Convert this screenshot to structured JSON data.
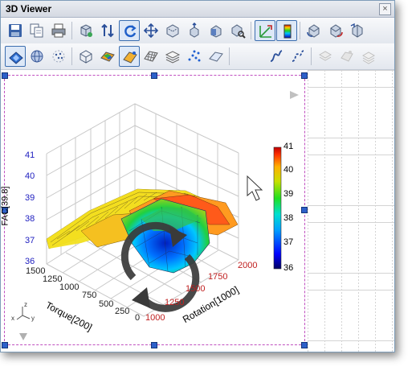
{
  "window": {
    "title": "3D Viewer",
    "close_glyph": "×"
  },
  "toolbar_row1": [
    "save-icon",
    "copy-icon",
    "print-icon",
    "rotate-box-icon",
    "align-axis-icon",
    "rotate-icon",
    "move-icon",
    "box-view-icon",
    "box-up-icon",
    "box-front-icon",
    "box-zoom-icon",
    "axis-swap-icon",
    "colorbar-icon",
    "cube-rotate-left-icon",
    "cube-rotate-right-icon",
    "cube-flip-icon"
  ],
  "toolbar_row2": [
    "surface-blue-icon",
    "sphere-grid-icon",
    "sphere-dots-icon",
    "wireframe-box-icon",
    "surface-color-icon",
    "surface-flat-icon",
    "mesh-surface-icon",
    "layers-icon",
    "scatter-points-icon",
    "plane-icon",
    "curve-icon",
    "curve-dashed-icon",
    "sheet-disabled-icon",
    "sheet-fill-disabled-icon",
    "sheet-lines-disabled-icon"
  ],
  "plot": {
    "z_label": "FAC[39.8]",
    "x_label": "Torque[200]",
    "y_label": "Rotation[1000]",
    "z_ticks": [
      "41",
      "40",
      "39",
      "38",
      "37",
      "36"
    ],
    "x_ticks": [
      "1500",
      "1250",
      "1000",
      "750",
      "500",
      "250",
      "0"
    ],
    "y_ticks": [
      "1000",
      "1250",
      "1500",
      "1750",
      "2000"
    ],
    "colorbar_ticks": [
      "41",
      "40",
      "39",
      "38",
      "37",
      "36"
    ],
    "triad": {
      "x": "x",
      "y": "y",
      "z": "z"
    },
    "colors": {
      "z_tick": "#2020c0",
      "x_tick": "#202020",
      "y_tick": "#c02020"
    }
  }
}
